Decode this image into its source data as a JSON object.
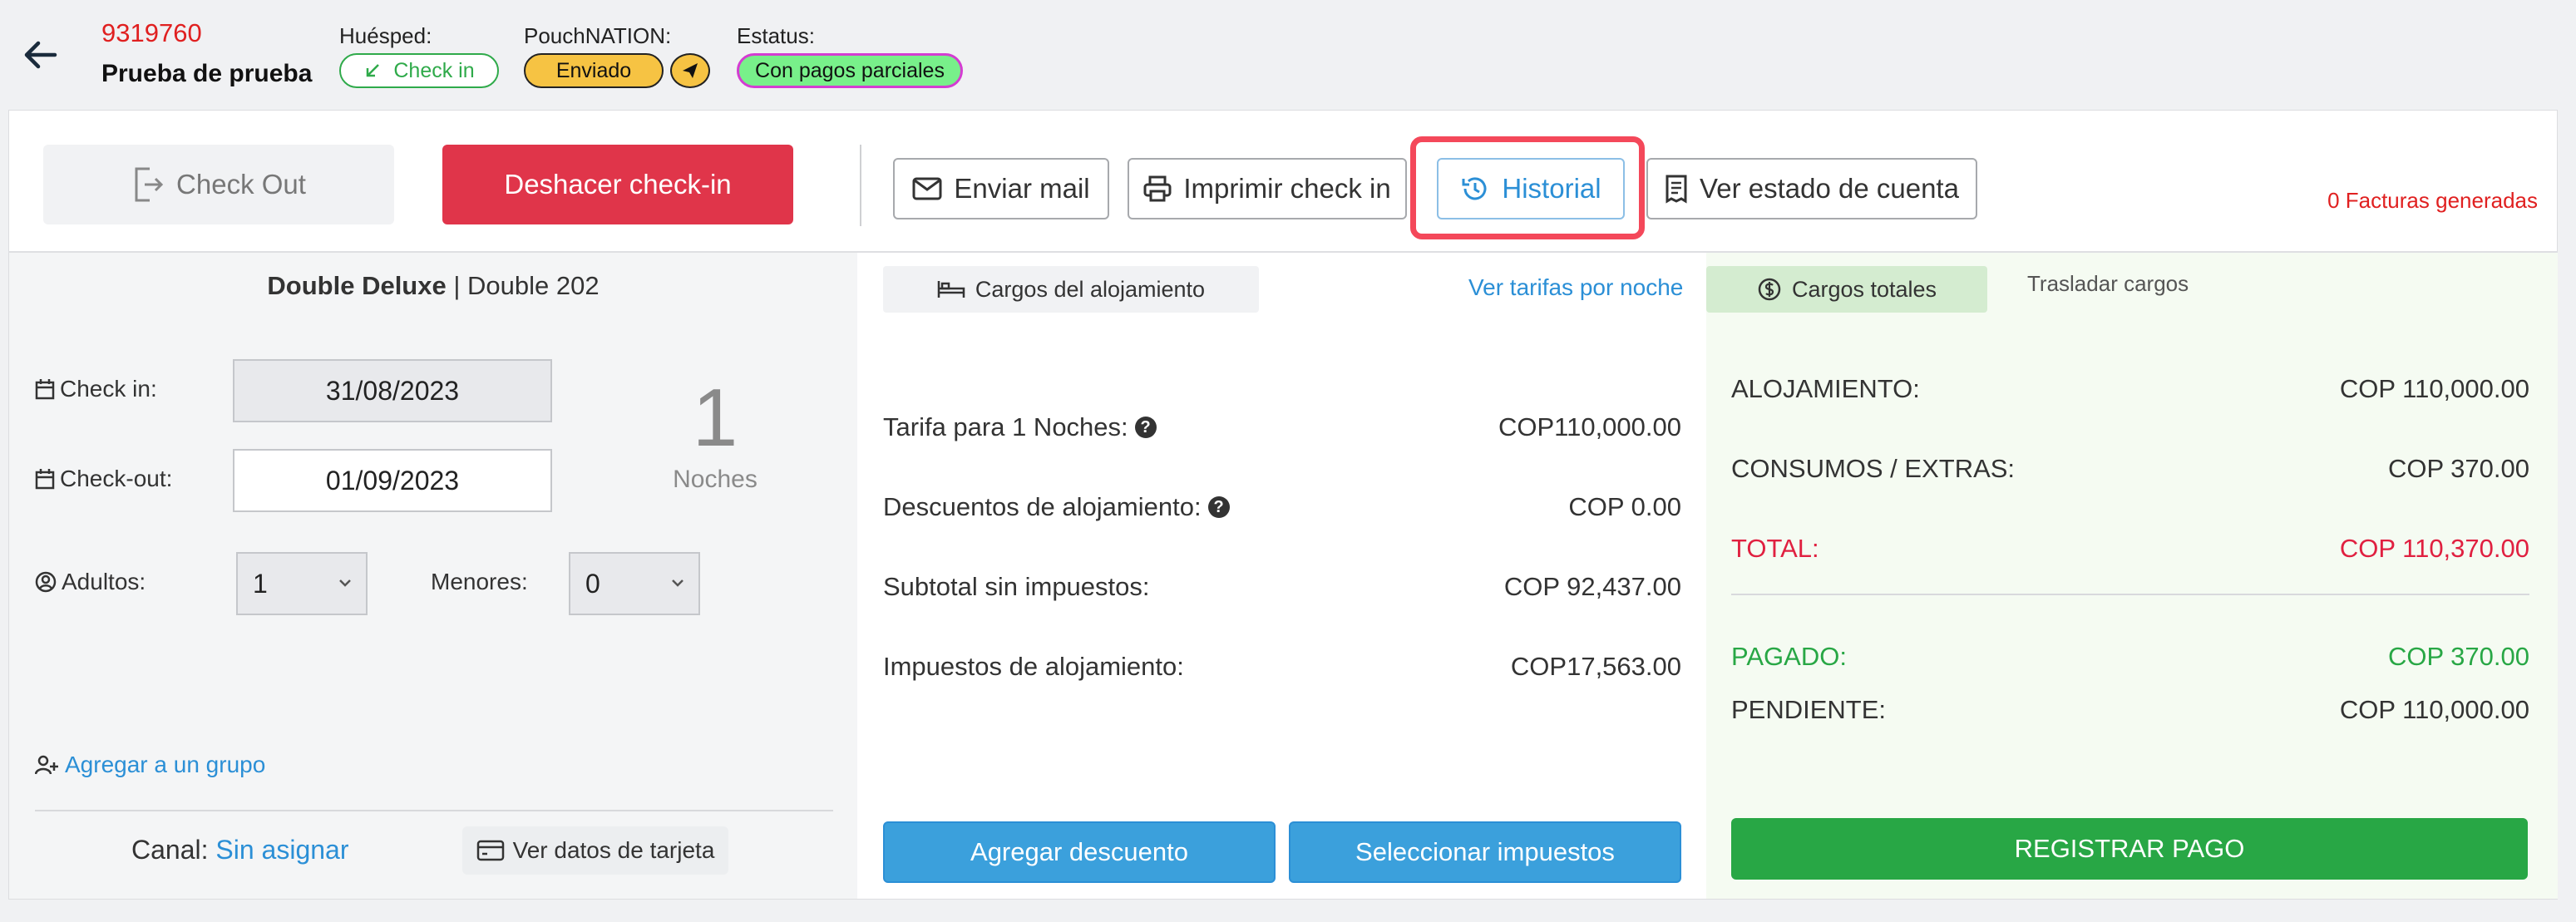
{
  "header": {
    "reservation_id": "9319760",
    "guest_name": "Prueba de prueba",
    "guest_label": "Huésped:",
    "guest_status": "Check in",
    "pouch_label": "PouchNATION:",
    "pouch_status": "Enviado",
    "status_label": "Estatus:",
    "status_value": "Con pagos parciales"
  },
  "toolbar": {
    "checkout_label": "Check Out",
    "undo_label": "Deshacer check-in",
    "mail_label": "Enviar mail",
    "print_label": "Imprimir check in",
    "history_label": "Historial",
    "account_label": "Ver estado de cuenta",
    "invoices": "0 Facturas generadas"
  },
  "room": {
    "type": "Double Deluxe",
    "separator": " | ",
    "name": "Double 202",
    "checkin_label": "Check in:",
    "checkin_date": "31/08/2023",
    "checkout_label": "Check-out:",
    "checkout_date": "01/09/2023",
    "nights_count": "1",
    "nights_label": "Noches",
    "adults_label": "Adultos:",
    "adults_value": "1",
    "minors_label": "Menores:",
    "minors_value": "0",
    "group_link": "Agregar a un grupo",
    "channel_label": "Canal:",
    "channel_value": "Sin asignar",
    "card_button": "Ver datos de tarjeta"
  },
  "lodging": {
    "tab_label": "Cargos del alojamiento",
    "rates_link": "Ver tarifas por noche",
    "rows": [
      {
        "label": "Tarifa para 1 Noches:",
        "value": "COP110,000.00"
      },
      {
        "label": "Descuentos de alojamiento:",
        "value": "COP 0.00"
      },
      {
        "label": "Subtotal sin impuestos:",
        "value": "COP 92,437.00"
      },
      {
        "label": "Impuestos de alojamiento:",
        "value": "COP17,563.00"
      }
    ],
    "discount_button": "Agregar descuento",
    "taxes_button": "Seleccionar impuestos"
  },
  "totals": {
    "tab_label": "Cargos totales",
    "transfer_label": "Trasladar cargos",
    "rows": [
      {
        "label": "ALOJAMIENTO:",
        "value": "COP 110,000.00"
      },
      {
        "label": "CONSUMOS / EXTRAS:",
        "value": "COP 370.00"
      },
      {
        "label": "TOTAL:",
        "value": "COP 110,370.00"
      },
      {
        "label": "PAGADO:",
        "value": "COP 370.00"
      },
      {
        "label": "PENDIENTE:",
        "value": "COP 110,000.00"
      }
    ],
    "pay_button": "REGISTRAR PAGO"
  },
  "colors": {
    "danger": "#e0354a",
    "link": "#2b8fd6",
    "success": "#28a745",
    "status_badge": "#78f08a",
    "pouch_badge": "#f6c343"
  }
}
